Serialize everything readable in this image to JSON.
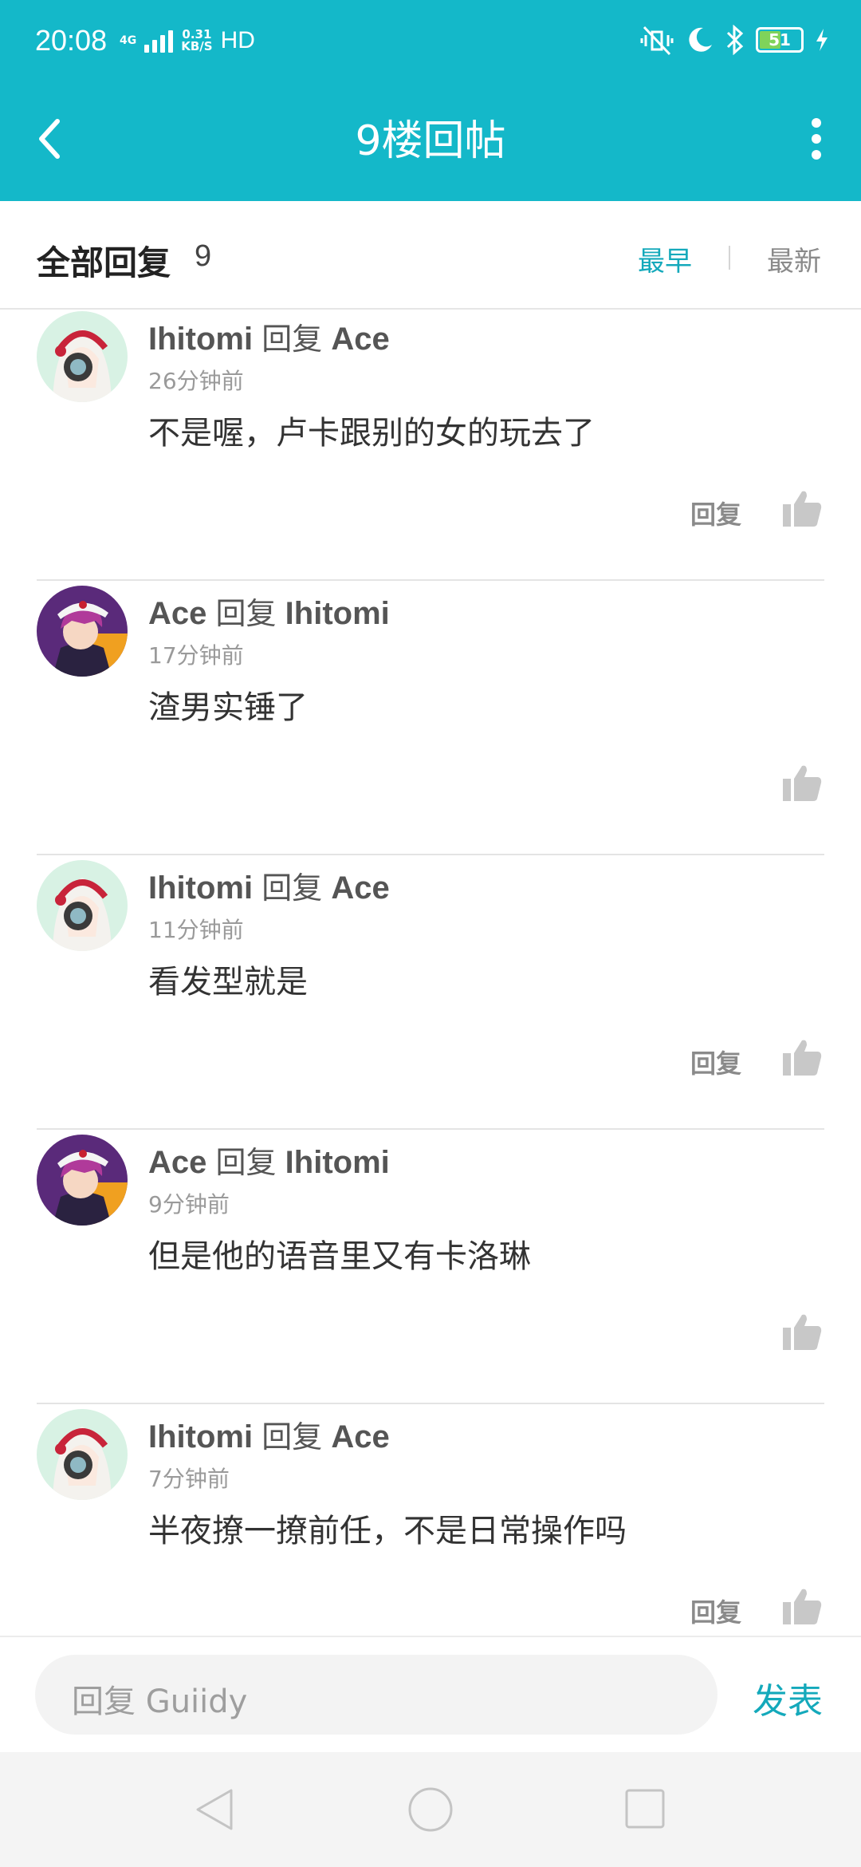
{
  "status_bar": {
    "time": "20:08",
    "network": "4G",
    "speed_value": "0.31",
    "speed_unit": "KB/S",
    "hd": "HD",
    "battery": "51",
    "battery_level": 0.51,
    "battery_color": "#7fd35a"
  },
  "header": {
    "title": "9楼回帖",
    "accent_color": "#14b8c9"
  },
  "section": {
    "title": "全部回复",
    "count": "9",
    "sort_earliest": "最早",
    "sort_latest": "最新",
    "active_sort": "最早"
  },
  "replies": [
    {
      "author": "Ihitomi",
      "reply_word": "回复",
      "target": "Ace",
      "time": "26分钟前",
      "text": "不是喔，卢卡跟别的女的玩去了",
      "reply_label": "回复",
      "avatar": "ihitomi"
    },
    {
      "author": "Ace",
      "reply_word": "回复",
      "target": "Ihitomi",
      "time": "17分钟前",
      "text": "渣男实锤了",
      "reply_label": "",
      "avatar": "ace"
    },
    {
      "author": "Ihitomi",
      "reply_word": "回复",
      "target": "Ace",
      "time": "11分钟前",
      "text": "看发型就是",
      "reply_label": "回复",
      "avatar": "ihitomi"
    },
    {
      "author": "Ace",
      "reply_word": "回复",
      "target": "Ihitomi",
      "time": "9分钟前",
      "text": "但是他的语音里又有卡洛琳",
      "reply_label": "",
      "avatar": "ace"
    },
    {
      "author": "Ihitomi",
      "reply_word": "回复",
      "target": "Ace",
      "time": "7分钟前",
      "text": "半夜撩一撩前任，不是日常操作吗",
      "reply_label": "回复",
      "avatar": "ihitomi"
    }
  ],
  "input": {
    "placeholder": "回复 Guiidy",
    "send_label": "发表"
  }
}
